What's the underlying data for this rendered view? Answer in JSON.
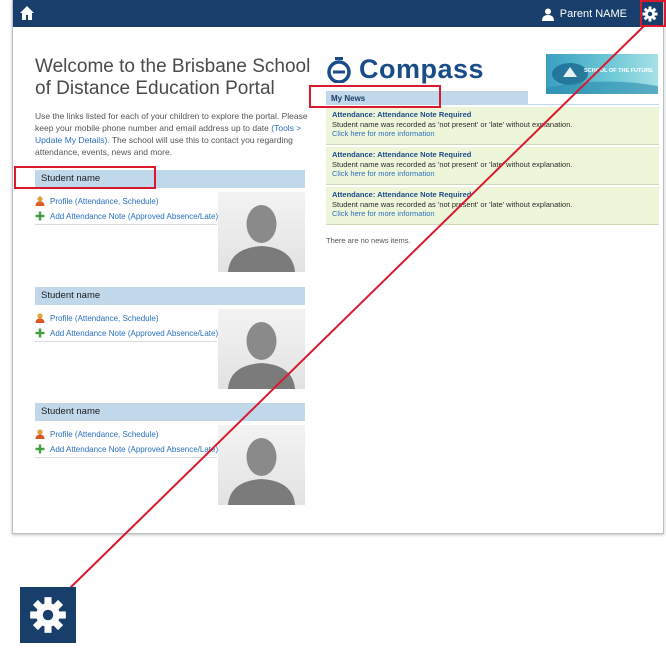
{
  "topbar": {
    "user_name": "Parent NAME"
  },
  "welcome": {
    "title": "Welcome to the Brisbane School of Distance Education Portal",
    "intro_1": "Use the links listed for each of your children to explore the portal. Please keep your mobile phone number and email address up to date ",
    "intro_link": "(Tools > Update My Details)",
    "intro_2": ". The school will use this to contact you regarding attendance, events, news and more."
  },
  "students": [
    {
      "name": "Student name",
      "links": [
        "Profile (Attendance, Schedule)",
        "Add Attendance Note (Approved Absence/Late)"
      ]
    },
    {
      "name": "Student name",
      "links": [
        "Profile (Attendance, Schedule)",
        "Add Attendance Note (Approved Absence/Late)"
      ]
    },
    {
      "name": "Student name",
      "links": [
        "Profile (Attendance, Schedule)",
        "Add Attendance Note (Approved Absence/Late)"
      ]
    }
  ],
  "branding": {
    "compass_name": "Compass",
    "banner_text": "SCHOOL OF THE FUTURE"
  },
  "news": {
    "tab_label": "My News",
    "items": [
      {
        "title": "Attendance: Attendance Note Required",
        "body": "Student name was recorded as 'not present' or 'late' without explanation.",
        "link": "Click here for more information"
      },
      {
        "title": "Attendance: Attendance Note Required",
        "body": "Student name was recorded as 'not present' or 'late' without explanation.",
        "link": "Click here for more information"
      },
      {
        "title": "Attendance: Attendance Note Required",
        "body": "Student name was recorded as 'not present' or 'late' without explanation.",
        "link": "Click here for more information"
      }
    ],
    "empty_text": "There are no news items."
  },
  "icons": {
    "home": "home-icon",
    "user": "user-icon",
    "settings": "gear-icon",
    "profile": "profile-icon",
    "add": "plus-icon"
  },
  "colors": {
    "topbar": "#183f6b",
    "section_header": "#c1d7ea",
    "news_bg": "#eef6d9",
    "link": "#2a6fbf",
    "annotation": "#d8192e"
  }
}
